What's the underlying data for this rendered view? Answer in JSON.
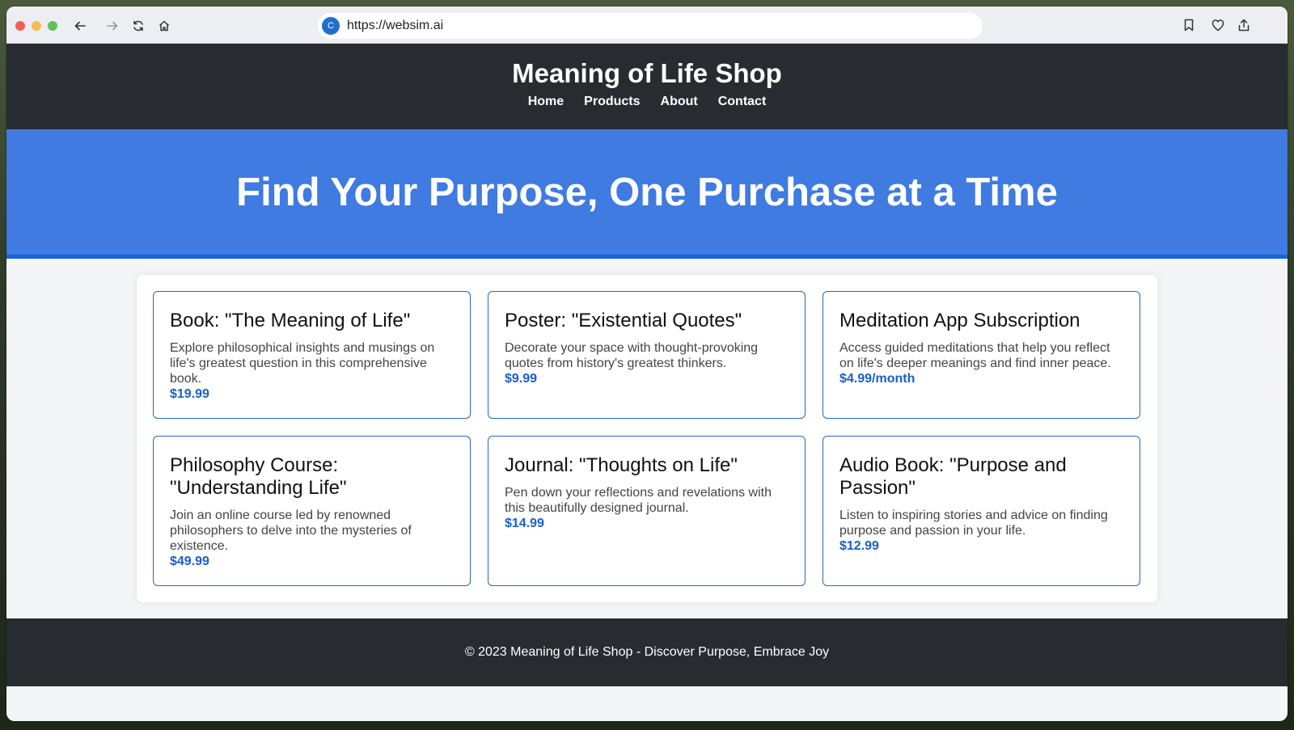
{
  "browser": {
    "url": "https://websim.ai",
    "site_icon_letter": "C"
  },
  "header": {
    "title": "Meaning of Life Shop",
    "nav": [
      "Home",
      "Products",
      "About",
      "Contact"
    ]
  },
  "hero": {
    "headline": "Find Your Purpose, One Purchase at a Time"
  },
  "products": [
    {
      "name": "Book: \"The Meaning of Life\"",
      "description": "Explore philosophical insights and musings on life's greatest question in this comprehensive book.",
      "price": "$19.99"
    },
    {
      "name": "Poster: \"Existential Quotes\"",
      "description": "Decorate your space with thought-provoking quotes from history's greatest thinkers.",
      "price": "$9.99"
    },
    {
      "name": "Meditation App Subscription",
      "description": "Access guided meditations that help you reflect on life's deeper meanings and find inner peace.",
      "price": "$4.99/month"
    },
    {
      "name": "Philosophy Course: \"Understanding Life\"",
      "description": "Join an online course led by renowned philosophers to delve into the mysteries of existence.",
      "price": "$49.99"
    },
    {
      "name": "Journal: \"Thoughts on Life\"",
      "description": "Pen down your reflections and revelations with this beautifully designed journal.",
      "price": "$14.99"
    },
    {
      "name": "Audio Book: \"Purpose and Passion\"",
      "description": "Listen to inspiring stories and advice on finding purpose and passion in your life.",
      "price": "$12.99"
    }
  ],
  "footer": {
    "text": "© 2023 Meaning of Life Shop - Discover Purpose, Embrace Joy"
  },
  "colors": {
    "header_bg": "#282c31",
    "hero_bg": "#3f7be0",
    "accent": "#1a5fcc"
  }
}
